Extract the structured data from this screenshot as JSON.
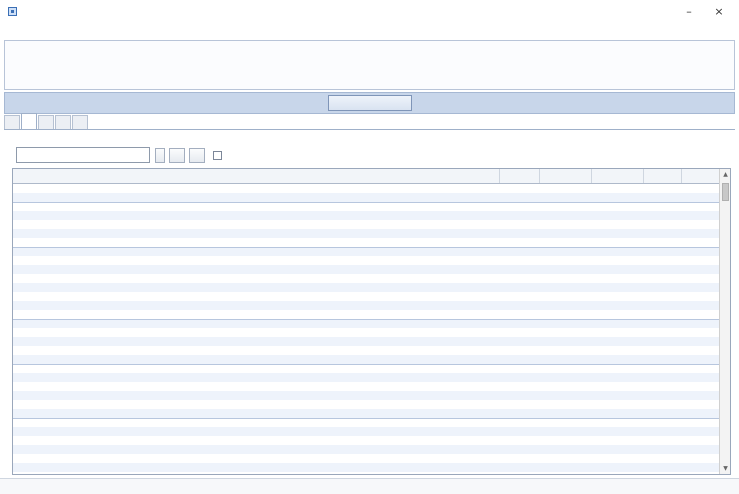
{
  "window": {
    "title": ""
  },
  "menu": [
    "",
    "",
    ""
  ],
  "info": {
    "lines": [
      "",
      "",
      "",
      ""
    ]
  },
  "main_button": "",
  "tabs": [
    {
      "label": "",
      "active": false
    },
    {
      "label": "",
      "active": true
    },
    {
      "label": "",
      "active": false
    },
    {
      "label": "",
      "active": false
    },
    {
      "label": "",
      "active": false
    }
  ],
  "description": "",
  "filter": {
    "label": "",
    "value": "",
    "placeholder": "",
    "clear_label": "",
    "button1": "",
    "button2": "",
    "checkbox_label": ""
  },
  "table": {
    "columns": [
      "",
      "",
      "",
      "",
      "",
      ""
    ],
    "rows": [
      [
        "",
        "",
        "",
        "",
        "",
        ""
      ],
      [
        "",
        "",
        "",
        "",
        "",
        ""
      ],
      [
        "",
        "",
        "",
        "",
        "",
        ""
      ],
      [
        "",
        "",
        "",
        "",
        "",
        ""
      ],
      [
        "",
        "",
        "",
        "",
        "",
        ""
      ],
      [
        "",
        "",
        "",
        "",
        "",
        ""
      ],
      [
        "",
        "",
        "",
        "",
        "",
        ""
      ],
      [
        "",
        "",
        "",
        "",
        "",
        ""
      ],
      [
        "",
        "",
        "",
        "",
        "",
        ""
      ],
      [
        "",
        "",
        "",
        "",
        "",
        ""
      ],
      [
        "",
        "",
        "",
        "",
        "",
        ""
      ],
      [
        "",
        "",
        "",
        "",
        "",
        ""
      ],
      [
        "",
        "",
        "",
        "",
        "",
        ""
      ],
      [
        "",
        "",
        "",
        "",
        "",
        ""
      ],
      [
        "",
        "",
        "",
        "",
        "",
        ""
      ],
      [
        "",
        "",
        "",
        "",
        "",
        ""
      ],
      [
        "",
        "",
        "",
        "",
        "",
        ""
      ],
      [
        "",
        "",
        "",
        "",
        "",
        ""
      ],
      [
        "",
        "",
        "",
        "",
        "",
        ""
      ],
      [
        "",
        "",
        "",
        "",
        "",
        ""
      ],
      [
        "",
        "",
        "",
        "",
        "",
        ""
      ],
      [
        "",
        "",
        "",
        "",
        "",
        ""
      ],
      [
        "",
        "",
        "",
        "",
        "",
        ""
      ],
      [
        "",
        "",
        "",
        "",
        "",
        ""
      ],
      [
        "",
        "",
        "",
        "",
        "",
        ""
      ],
      [
        "",
        "",
        "",
        "",
        "",
        ""
      ],
      [
        "",
        "",
        "",
        "",
        "",
        ""
      ],
      [
        "",
        "",
        "",
        "",
        "",
        ""
      ],
      [
        "",
        "",
        "",
        "",
        "",
        ""
      ],
      [
        "",
        "",
        "",
        "",
        "",
        ""
      ],
      [
        "",
        "",
        "",
        "",
        "",
        ""
      ],
      [
        "",
        "",
        "",
        "",
        "",
        ""
      ]
    ]
  },
  "status": {
    "text": ""
  },
  "colors": {
    "accent": "#3b6fb5",
    "band": "#c8d6ea",
    "row_alt": "#eef3fb"
  },
  "icons": {
    "app": "app-icon",
    "minimize": "minimize-icon",
    "close": "close-icon",
    "scroll_up": "chevron-up-icon",
    "scroll_down": "chevron-down-icon"
  }
}
